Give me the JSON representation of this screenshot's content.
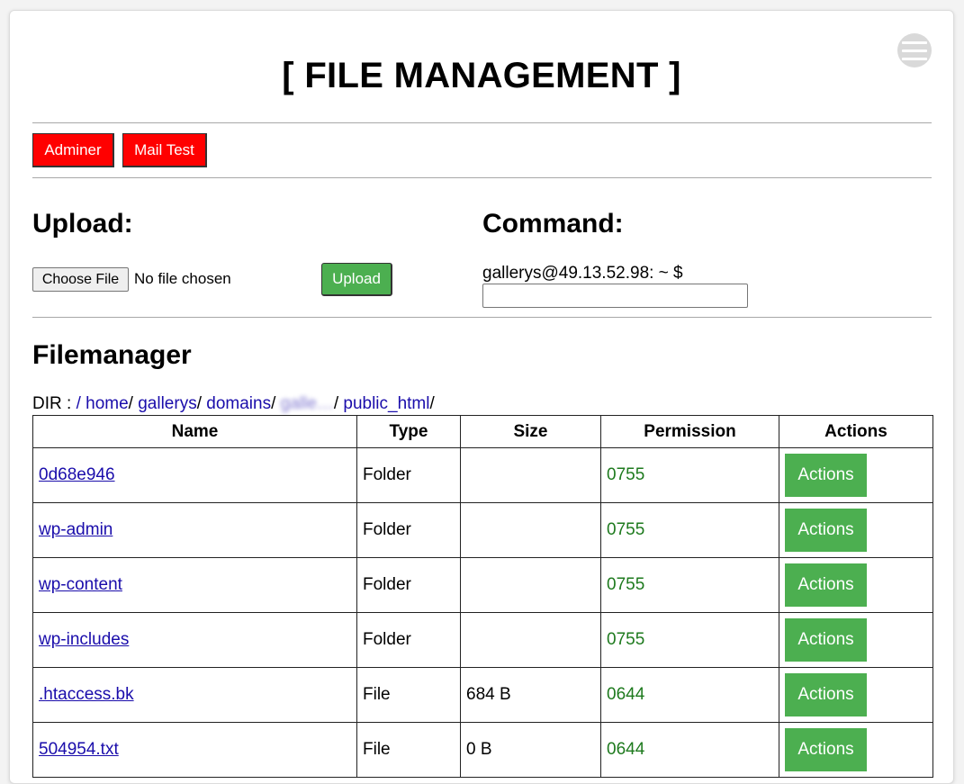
{
  "header": {
    "title": "[ FILE MANAGEMENT ]",
    "menu_icon": "hamburger-menu-icon"
  },
  "toolbar": {
    "adminer_label": "Adminer",
    "mailtest_label": "Mail Test"
  },
  "upload": {
    "heading": "Upload:",
    "choose_label": "Choose File",
    "no_file_text": "No file chosen",
    "upload_label": "Upload"
  },
  "command": {
    "heading": "Command:",
    "prompt": "gallerys@49.13.52.98: ~ $",
    "input_value": ""
  },
  "filemanager": {
    "heading": "Filemanager",
    "dir_label": "DIR :",
    "breadcrumb": [
      "/",
      "home",
      "gallerys",
      "domains",
      "galle…",
      "public_html"
    ],
    "columns": [
      "Name",
      "Type",
      "Size",
      "Permission",
      "Actions"
    ],
    "rows": [
      {
        "name": "0d68e946",
        "type": "Folder",
        "size": "",
        "permission": "0755",
        "action": "Actions"
      },
      {
        "name": "wp-admin",
        "type": "Folder",
        "size": "",
        "permission": "0755",
        "action": "Actions"
      },
      {
        "name": "wp-content",
        "type": "Folder",
        "size": "",
        "permission": "0755",
        "action": "Actions"
      },
      {
        "name": "wp-includes",
        "type": "Folder",
        "size": "",
        "permission": "0755",
        "action": "Actions"
      },
      {
        "name": ".htaccess.bk",
        "type": "File",
        "size": "684 B",
        "permission": "0644",
        "action": "Actions"
      },
      {
        "name": "504954.txt",
        "type": "File",
        "size": "0 B",
        "permission": "0644",
        "action": "Actions"
      }
    ]
  },
  "colors": {
    "danger": "#ff0000",
    "success": "#4caf50",
    "link": "#1a0dab",
    "permission": "#1e7a1e"
  }
}
